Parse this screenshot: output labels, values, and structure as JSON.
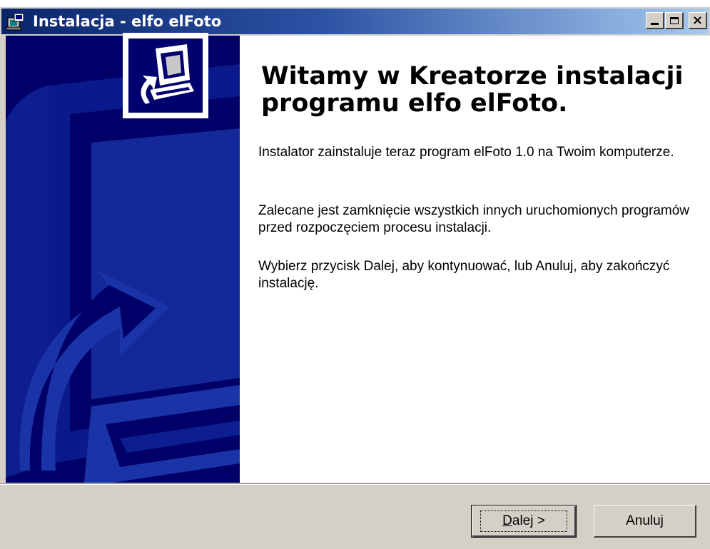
{
  "window": {
    "title": "Instalacja - elfo elFoto",
    "title_icon": "installer-icon",
    "controls": {
      "minimize_icon": "minimize-icon",
      "maximize_icon": "maximize-icon",
      "close_icon": "close-icon",
      "close_glyph": "×"
    }
  },
  "colors": {
    "titlebar_start": "#0a246a",
    "titlebar_end": "#a6caf0",
    "side_panel": "#000068",
    "face": "#d4d0c8"
  },
  "side_panel": {
    "image": "wizard-computer-graphic",
    "logo_icon": "computer-install-icon"
  },
  "content": {
    "heading": "Witamy w Kreatorze instalacji programu elfo elFoto.",
    "paragraph1": "Instalator zainstaluje teraz program elFoto 1.0 na Twoim komputerze.",
    "paragraph2": "Zalecane jest zamknięcie wszystkich innych uruchomionych programów przed rozpoczęciem procesu instalacji.",
    "paragraph3": "Wybierz przycisk Dalej, aby kontynuować, lub Anuluj, aby zakończyć instalację."
  },
  "buttons": {
    "next_accel": "D",
    "next_rest": "alej >",
    "cancel": "Anuluj"
  }
}
